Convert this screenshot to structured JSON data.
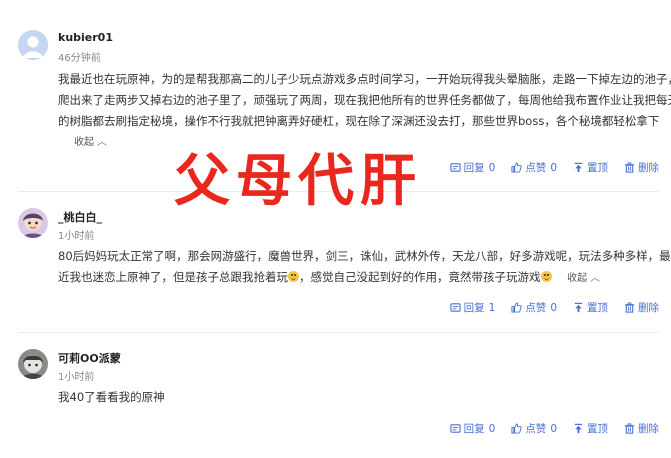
{
  "comments": [
    {
      "username": "kubier01",
      "time": "46分钟前",
      "lines": [
        "我最近也在玩原神，为的是帮我那高二的儿子少玩点游戏多点时间学习，一开始玩得我头晕脑胀，走路一下掉左边的池子，",
        "爬出来了走两步又掉右边的池子里了，顽强玩了两周，现在我把他所有的世界任务都做了，每周他给我布置作业让我把每天",
        "的树脂都去刷指定秘境，操作不行我就把钟离弄好硬杠，现在除了深渊还没去打，那些世界boss，各个秘境都轻松拿下"
      ],
      "collapse": "收起",
      "reply_label": "回复",
      "reply_count": "0",
      "like_label": "点赞",
      "like_count": "0",
      "top_label": "置顶",
      "delete_label": "删除"
    },
    {
      "username": "_桃白白_",
      "time": "1小时前",
      "line1": "80后妈妈玩太正常了啊，那会网游盛行，魔兽世界，剑三，诛仙，武林外传，天龙八部，好多游戏呢，玩法多种多样，最",
      "line2a": "近我也迷恋上原神了，但是孩子总跟我抢着玩",
      "line2b": "，感觉自己没起到好的作用，竟然带孩子玩游戏",
      "collapse": "收起",
      "reply_label": "回复",
      "reply_count": "1",
      "like_label": "点赞",
      "like_count": "0",
      "top_label": "置顶",
      "delete_label": "删除"
    },
    {
      "username": "可莉OO派蒙",
      "time": "1小时前",
      "text": "我40了看看我的原神",
      "reply_label": "回复",
      "reply_count": "0",
      "like_label": "点赞",
      "like_count": "0",
      "top_label": "置顶",
      "delete_label": "删除"
    }
  ],
  "overlay_text": "父母代肝",
  "colors": {
    "overlay": "#e8281f",
    "action": "#4a6fd3"
  }
}
